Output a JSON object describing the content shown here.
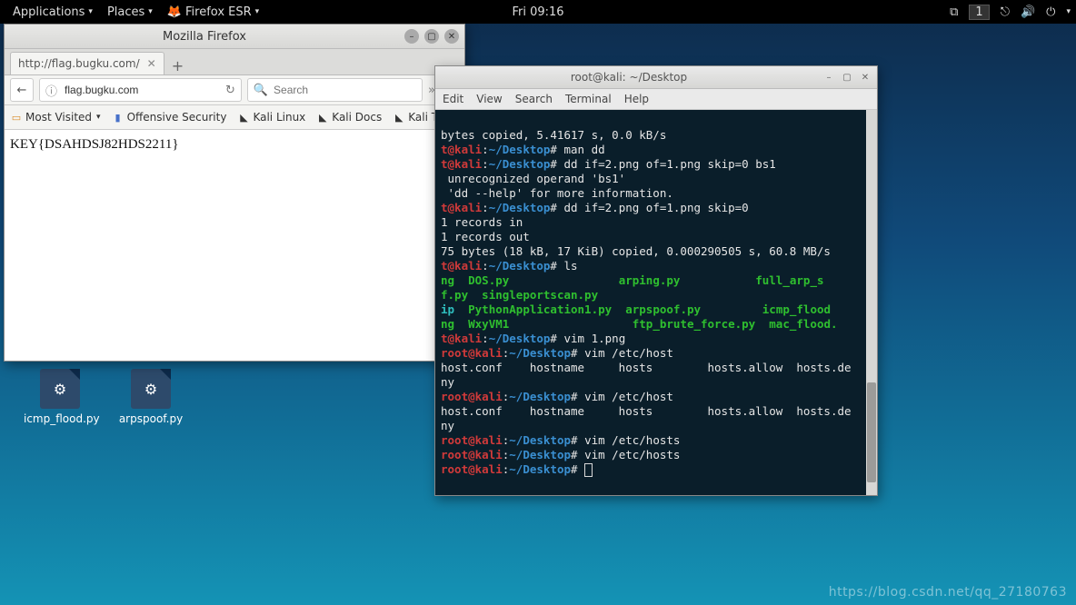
{
  "topbar": {
    "applications": "Applications",
    "places": "Places",
    "app_current": "Firefox ESR",
    "clock": "Fri 09:16",
    "workspace": "1"
  },
  "desktop_icons": [
    {
      "label": "icmp_flood.py"
    },
    {
      "label": "arpspoof.py"
    }
  ],
  "firefox": {
    "title": "Mozilla Firefox",
    "tab": {
      "label": "http://flag.bugku.com/"
    },
    "url": "flag.bugku.com",
    "search_placeholder": "Search",
    "bookmarks": [
      "Most Visited",
      "Offensive Security",
      "Kali Linux",
      "Kali Docs",
      "Kali Tools"
    ],
    "page_text": "KEY{DSAHDSJ82HDS2211}"
  },
  "terminal": {
    "title": "root@kali: ~/Desktop",
    "menu": [
      "Edit",
      "View",
      "Search",
      "Terminal",
      "Help"
    ],
    "lines": [
      {
        "raw": "bytes copied, 5.41617 s, 0.0 kB/s"
      },
      {
        "raw": ""
      },
      {
        "prompt": true,
        "cmd": "man dd"
      },
      {
        "prompt": true,
        "cmd": "dd if=2.png of=1.png skip=0 bs1"
      },
      {
        "raw": " unrecognized operand 'bs1'"
      },
      {
        "raw": " 'dd --help' for more information."
      },
      {
        "prompt": true,
        "cmd": "dd if=2.png of=1.png skip=0"
      },
      {
        "raw": "1 records in"
      },
      {
        "raw": "1 records out"
      },
      {
        "raw": "75 bytes (18 kB, 17 KiB) copied, 0.000290505 s, 60.8 MB/s"
      },
      {
        "prompt": true,
        "cmd": "ls"
      },
      {
        "ls": [
          {
            "t": "ng",
            "c": "grn"
          },
          {
            "t": "  "
          },
          {
            "t": "DOS.py",
            "c": "grn"
          },
          {
            "t": "                "
          },
          {
            "t": "arping.py",
            "c": "grn"
          },
          {
            "t": "           "
          },
          {
            "t": "full_arp_s",
            "c": "grn"
          }
        ]
      },
      {
        "ls": [
          {
            "t": "f.py",
            "c": "grn"
          },
          {
            "t": "  "
          },
          {
            "t": "singleportscan.py",
            "c": "grn"
          }
        ]
      },
      {
        "ls": [
          {
            "t": "ip",
            "c": "cy"
          },
          {
            "t": "  "
          },
          {
            "t": "PythonApplication1.py",
            "c": "grn"
          },
          {
            "t": "  "
          },
          {
            "t": "arpspoof.py",
            "c": "grn"
          },
          {
            "t": "         "
          },
          {
            "t": "icmp_flood",
            "c": "grn"
          }
        ]
      },
      {
        "raw": ""
      },
      {
        "ls": [
          {
            "t": "ng",
            "c": "grn"
          },
          {
            "t": "  "
          },
          {
            "t": "WxyVM1",
            "c": "grn"
          },
          {
            "t": "                  "
          },
          {
            "t": "ftp_brute_force.py",
            "c": "grn"
          },
          {
            "t": "  "
          },
          {
            "t": "mac_flood.",
            "c": "grn"
          }
        ]
      },
      {
        "raw": ""
      },
      {
        "prompt": true,
        "cmd": "vim 1.png"
      },
      {
        "prompt_full": true,
        "cmd": "vim /etc/host"
      },
      {
        "raw": "host.conf    hostname     hosts        hosts.allow  hosts.de"
      },
      {
        "raw": "ny"
      },
      {
        "prompt_full": true,
        "cmd": "vim /etc/host"
      },
      {
        "raw": "host.conf    hostname     hosts        hosts.allow  hosts.de"
      },
      {
        "raw": "ny"
      },
      {
        "prompt_full": true,
        "cmd": "vim /etc/hosts"
      },
      {
        "prompt_full": true,
        "cmd": "vim /etc/hosts"
      },
      {
        "prompt_full": true,
        "cmd": "",
        "cursor": true
      }
    ],
    "prompt_user_trunc": "t@kali",
    "prompt_user": "root@kali",
    "prompt_path": "~/Desktop",
    "prompt_sep": ":",
    "prompt_sym": "#"
  },
  "watermark": "https://blog.csdn.net/qq_27180763"
}
